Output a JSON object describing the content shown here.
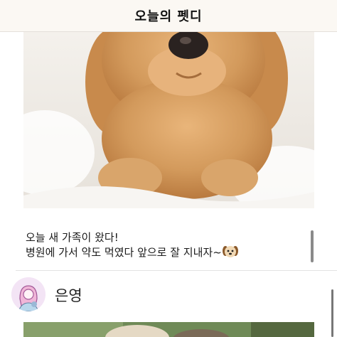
{
  "header": {
    "title": "오늘의 펫디"
  },
  "post": {
    "photo_icon": "puppy-photo",
    "caption_lines": [
      "오늘 새 가족이 왔다!",
      "병원에 가서 약도 먹였다  앞으로 잘 지내자~"
    ],
    "caption_emoji": "dog-face-icon"
  },
  "next_post": {
    "username": "은영",
    "avatar_icon": "user-avatar-icon",
    "photo_icon": "dog-photo"
  },
  "colors": {
    "header_bg": "#fbf8f3",
    "puppy_fur": "#d39a5c",
    "blanket": "#f6f3ef",
    "avatar_bg": "#f3e4f5"
  }
}
